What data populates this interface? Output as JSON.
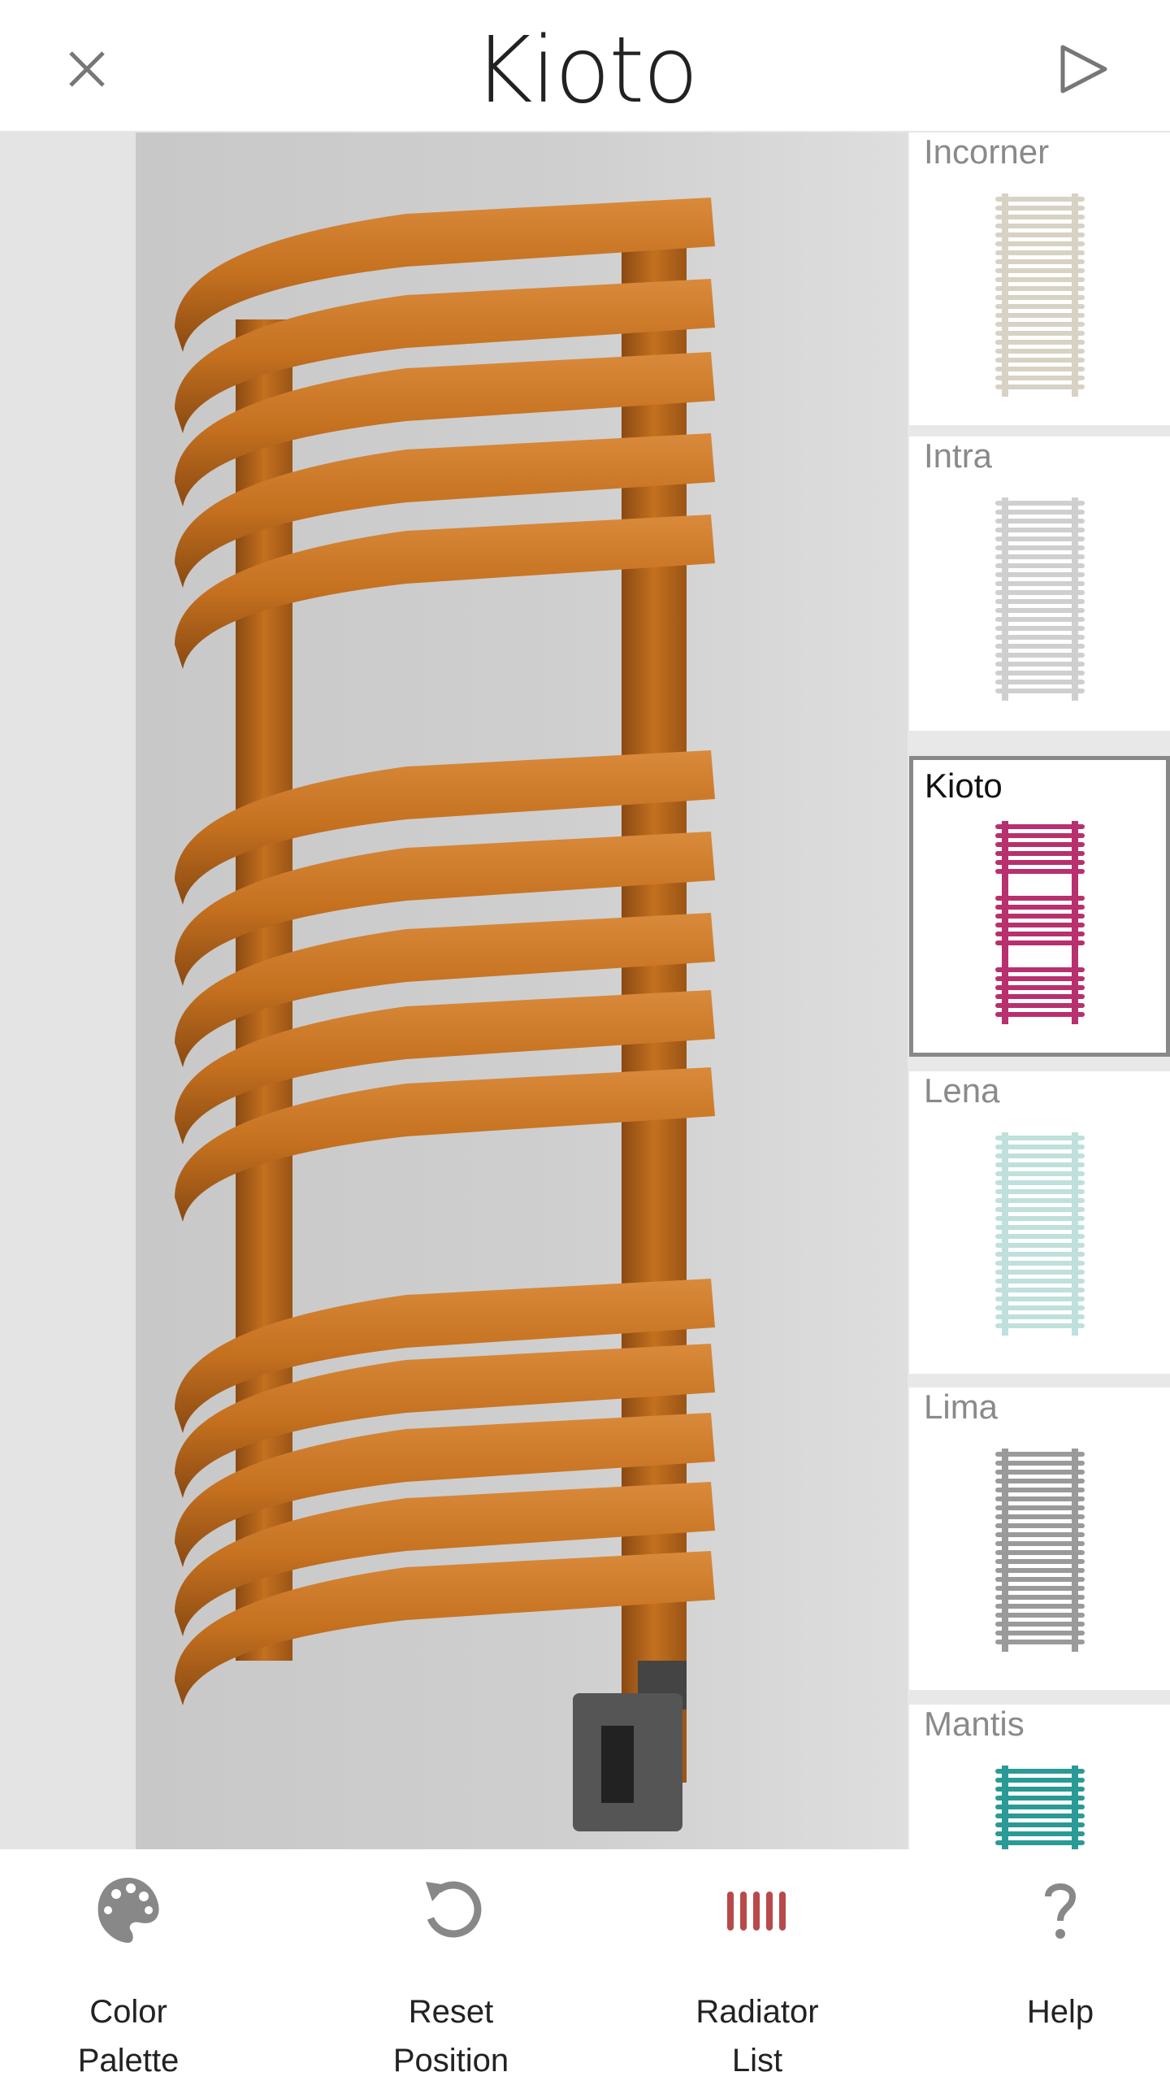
{
  "header": {
    "title": "Kioto",
    "close_icon": "close-icon",
    "play_icon": "play-icon"
  },
  "viewer": {
    "product_color": "#c4701f",
    "controller_color": "#555555"
  },
  "radiator_list": {
    "selected": "Kioto",
    "items": [
      {
        "name": "Incorner",
        "thumb_color": "#d8d2c4"
      },
      {
        "name": "Intra",
        "thumb_color": "#cfcfcf"
      },
      {
        "name": "Kioto",
        "thumb_color": "#b8306e"
      },
      {
        "name": "Lena",
        "thumb_color": "#bfe0dc"
      },
      {
        "name": "Lima",
        "thumb_color": "#9a9a9a"
      },
      {
        "name": "Mantis",
        "thumb_color": "#2a9a96"
      }
    ]
  },
  "toolbar": {
    "items": [
      {
        "line1": "Color",
        "line2": "Palette",
        "icon": "palette-icon"
      },
      {
        "line1": "Reset",
        "line2": "Position",
        "icon": "reset-icon"
      },
      {
        "line1": "Radiator",
        "line2": "List",
        "icon": "radiator-icon",
        "accent": "#b84a4a"
      },
      {
        "line1": "Help",
        "line2": "",
        "icon": "help-icon"
      }
    ]
  }
}
